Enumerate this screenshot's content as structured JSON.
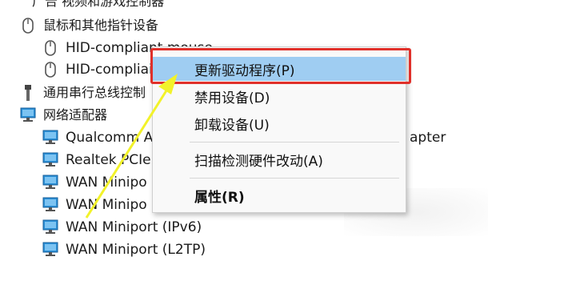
{
  "tree": {
    "cut_top_text": "广告   视频和游戏控制器",
    "mouse_category": "鼠标和其他指针设备",
    "mouse_devices": [
      "HID-compliant mouse",
      "HID-compliai"
    ],
    "usb_category": "通用串行总线控制",
    "network_category": "网络适配器",
    "network_devices": [
      "Qualcomm A",
      "Realtek PCIe",
      "WAN Minipo",
      "WAN Minipo",
      "WAN Miniport (IPv6)",
      "WAN Miniport (L2TP)"
    ],
    "right_overflow_text": "apter"
  },
  "context_menu": {
    "items": [
      {
        "label": "更新驱动程序(P)",
        "highlighted": true
      },
      {
        "label": "禁用设备(D)"
      },
      {
        "label": "卸载设备(U)"
      },
      {
        "label": "扫描检测硬件改动(A)"
      },
      {
        "label": "属性(R)",
        "bold": true
      }
    ]
  },
  "colors": {
    "highlight_bg": "#9fcdf2",
    "highlight_border": "#e0302a",
    "arrow": "#f2f22a",
    "network_icon": "#2a8fd6"
  },
  "icons": {
    "mouse": "mouse-icon",
    "usb": "usb-icon",
    "network": "network-adapter-icon"
  }
}
